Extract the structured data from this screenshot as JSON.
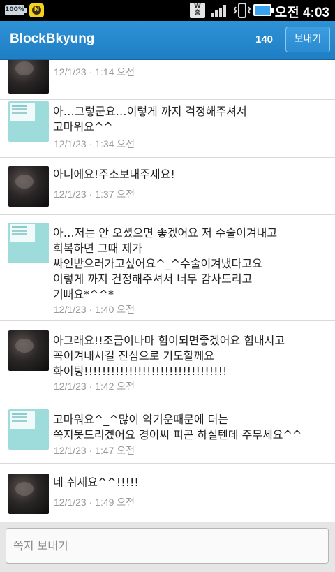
{
  "status_bar": {
    "battery_label": "100%",
    "kakao_label": "N",
    "w_label": "W\n홈",
    "time": "오전 4:03"
  },
  "header": {
    "title": "BlockBkyung",
    "count": "140",
    "send_label": "보내기",
    "accent_color": "#1f7ec4"
  },
  "messages": [
    {
      "avatar": "dark",
      "text": "",
      "time": "12/1/23 · 1:14 오전"
    },
    {
      "avatar": "teal",
      "text": "아…그렇군요…이렇게 까지 걱정해주셔서\n고마워요^^",
      "time": "12/1/23 · 1:34 오전"
    },
    {
      "avatar": "dark",
      "text": "아니에요!주소보내주세요!",
      "time": "12/1/23 · 1:37 오전"
    },
    {
      "avatar": "teal",
      "text": "아…저는 안 오셨으면 좋겠어요 저 수술이겨내고\n회복하면 그때 제가\n싸인받으러가고싶어요^_^수술이겨냈다고요\n이렇게 까지 건정해주셔서 너무 감사드리고\n기뻐요*^^*",
      "time": "12/1/23 · 1:40 오전"
    },
    {
      "avatar": "dark",
      "text": "아그래요!!조금이나마 힘이되면좋겠어요 힘내시고\n꼭이겨내시길 진심으로 기도할께요\n화이팅!!!!!!!!!!!!!!!!!!!!!!!!!!!!!!!!",
      "time": "12/1/23 · 1:42 오전"
    },
    {
      "avatar": "teal",
      "text": "고마워요^_^많이 약기운때문에 더는\n쪽지못드리겠어요 경이씨 피곤 하실텐데 주무세요^^",
      "time": "12/1/23 · 1:47 오전"
    },
    {
      "avatar": "dark",
      "text": "네 쉬세요^^!!!!!",
      "time": "12/1/23 · 1:49 오전"
    }
  ],
  "composer": {
    "placeholder": "쪽지 보내기"
  }
}
